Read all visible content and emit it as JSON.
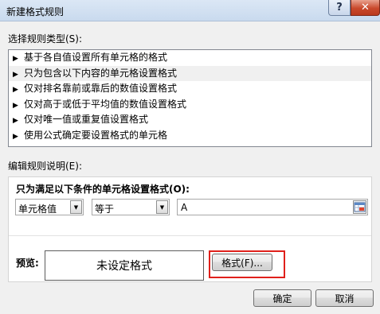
{
  "window": {
    "title": "新建格式规则",
    "help_label": "?",
    "close_label": "✕"
  },
  "rule_type": {
    "label": "选择规则类型(S):",
    "items": [
      "基于各自值设置所有单元格的格式",
      "只为包含以下内容的单元格设置格式",
      "仅对排名靠前或靠后的数值设置格式",
      "仅对高于或低于平均值的数值设置格式",
      "仅对唯一值或重复值设置格式",
      "使用公式确定要设置格式的单元格"
    ],
    "selected_index": 1,
    "bullet": "▶"
  },
  "rule_description": {
    "label": "编辑规则说明(E):",
    "heading": "只为满足以下条件的单元格设置格式(O):",
    "condition_type": "单元格值",
    "operator": "等于",
    "value": "A"
  },
  "preview": {
    "label": "预览:",
    "text": "未设定格式",
    "format_button": "格式(F)..."
  },
  "buttons": {
    "ok": "确定",
    "cancel": "取消"
  },
  "colors": {
    "highlight": "#e0201b",
    "dialog_bg": "#f0f0f0"
  }
}
